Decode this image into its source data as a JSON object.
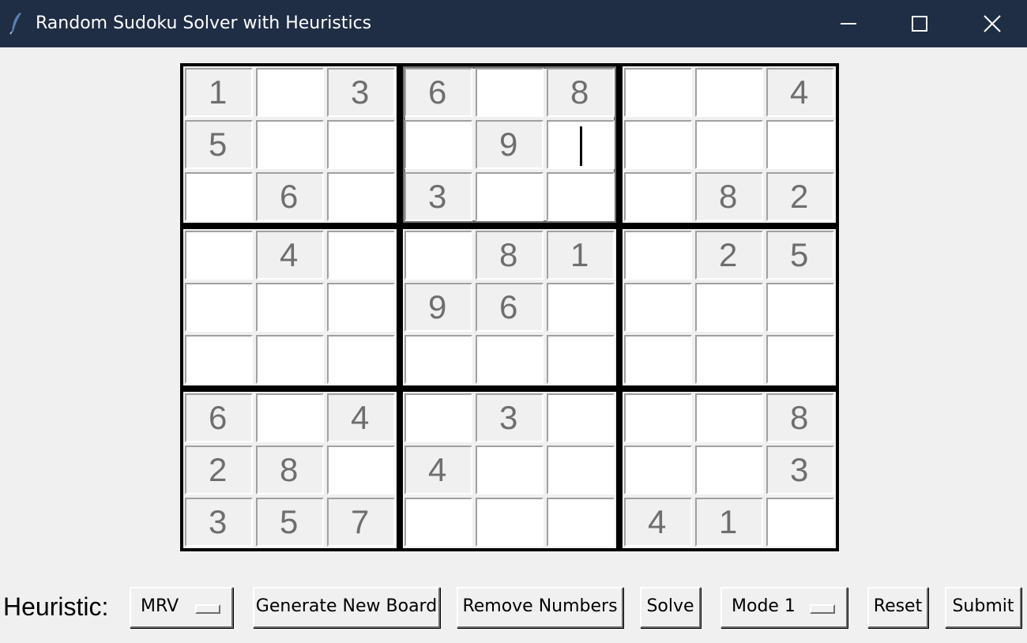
{
  "window": {
    "title": "Random Sudoku Solver with Heuristics"
  },
  "icons": {
    "app": "feather-icon",
    "minimize": "minimize-icon",
    "maximize": "maximize-icon",
    "close": "close-icon"
  },
  "board": {
    "grid": [
      [
        "1",
        "",
        "3",
        "6",
        "",
        "8",
        "",
        "",
        "4"
      ],
      [
        "5",
        "",
        "",
        "",
        "9",
        "",
        "",
        "",
        ""
      ],
      [
        "",
        "6",
        "",
        "3",
        "",
        "",
        "",
        "8",
        "2"
      ],
      [
        "",
        "4",
        "",
        "",
        "8",
        "1",
        "",
        "2",
        "5"
      ],
      [
        "",
        "",
        "",
        "9",
        "6",
        "",
        "",
        "",
        ""
      ],
      [
        "",
        "",
        "",
        "",
        "",
        "",
        "",
        "",
        ""
      ],
      [
        "6",
        "",
        "4",
        "",
        "3",
        "",
        "",
        "",
        "8"
      ],
      [
        "2",
        "8",
        "",
        "4",
        "",
        "",
        "",
        "",
        "3"
      ],
      [
        "3",
        "5",
        "7",
        "",
        "",
        "",
        "4",
        "1",
        ""
      ]
    ],
    "focused_cell": [
      1,
      5
    ]
  },
  "controls": {
    "heuristic_label": "Heuristic:",
    "heuristic_value": "MRV",
    "generate_label": "Generate New Board",
    "remove_label": "Remove Numbers",
    "solve_label": "Solve",
    "mode_value": "Mode 1",
    "reset_label": "Reset",
    "submit_label": "Submit"
  },
  "colors": {
    "titlebar_bg": "#1f2d45",
    "window_bg": "#f0f0f0",
    "given_cell_bg": "#f0f0f0",
    "empty_cell_bg": "#ffffff",
    "digit_color": "#6e6e6e",
    "grid_lines": "#000000"
  }
}
